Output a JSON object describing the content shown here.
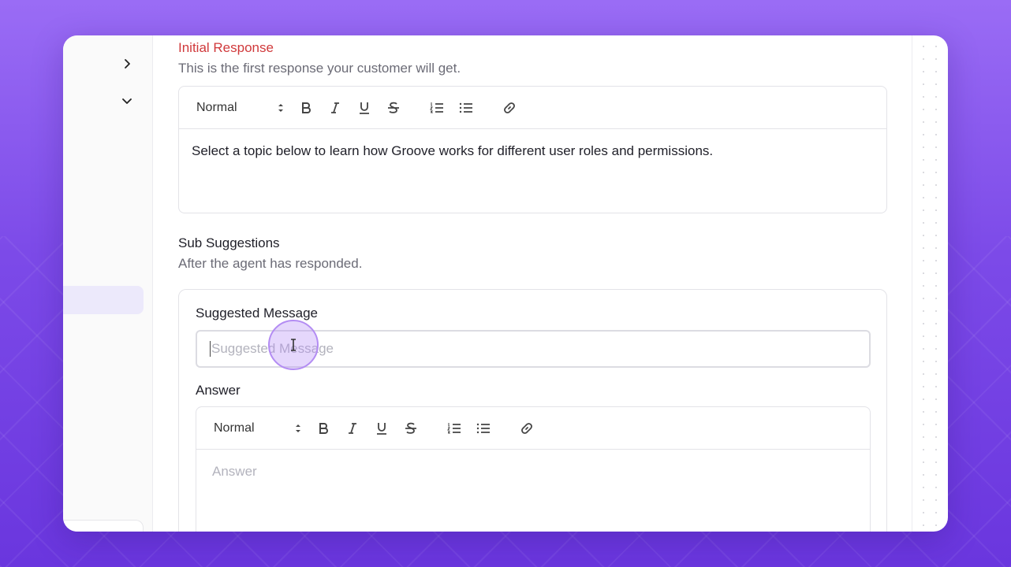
{
  "initial_response": {
    "title": "Initial Response",
    "subtitle": "This is the first response your customer will get.",
    "editor": {
      "format_select": "Normal",
      "body": "Select a topic below to learn how Groove works for different user roles and permissions."
    }
  },
  "sub_suggestions": {
    "title": "Sub Suggestions",
    "subtitle": "After the agent has responded.",
    "suggested_message": {
      "label": "Suggested Message",
      "placeholder": "Suggested Message",
      "value": ""
    },
    "answer": {
      "label": "Answer",
      "format_select": "Normal",
      "placeholder": "Answer"
    }
  },
  "colors": {
    "accent_red": "#d0393b",
    "brand_purple": "#7c4ae8"
  },
  "icons": {
    "toolbar": [
      "bold-icon",
      "italic-icon",
      "underline-icon",
      "strike-icon",
      "ordered-list-icon",
      "bullet-list-icon",
      "link-icon"
    ]
  }
}
